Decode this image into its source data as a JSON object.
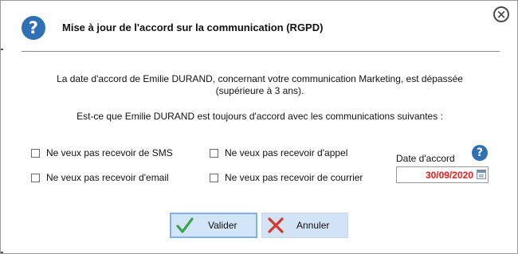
{
  "dialog": {
    "title": "Mise à jour de l'accord sur la communication (RGPD)",
    "message_line1": "La date d'accord de Emilie DURAND, concernant votre communication Marketing, est dépassée",
    "message_line2": "(supérieure à 3 ans).",
    "question": "Est-ce que Emilie DURAND est toujours d'accord avec les communications suivantes :"
  },
  "options": {
    "sms": "Ne veux pas recevoir de SMS",
    "email": "Ne veux pas recevoir d'email",
    "appel": "Ne veux pas recevoir d'appel",
    "courrier": "Ne veux pas recevoir de courrier"
  },
  "date": {
    "label": "Date d'accord",
    "value": "30/09/2020"
  },
  "buttons": {
    "valider": "Valider",
    "annuler": "Annuler"
  },
  "icons": {
    "header": "question-icon",
    "help": "question-icon",
    "close": "close-icon",
    "valider": "checkmark-icon",
    "annuler": "cross-icon",
    "calendar": "calendar-icon"
  },
  "colors": {
    "accent_blue": "#2f6fb3",
    "date_red": "#e0201c",
    "button_bg": "#d6e6f8",
    "check_green": "#3aa84a",
    "cross_red": "#d9342b"
  }
}
